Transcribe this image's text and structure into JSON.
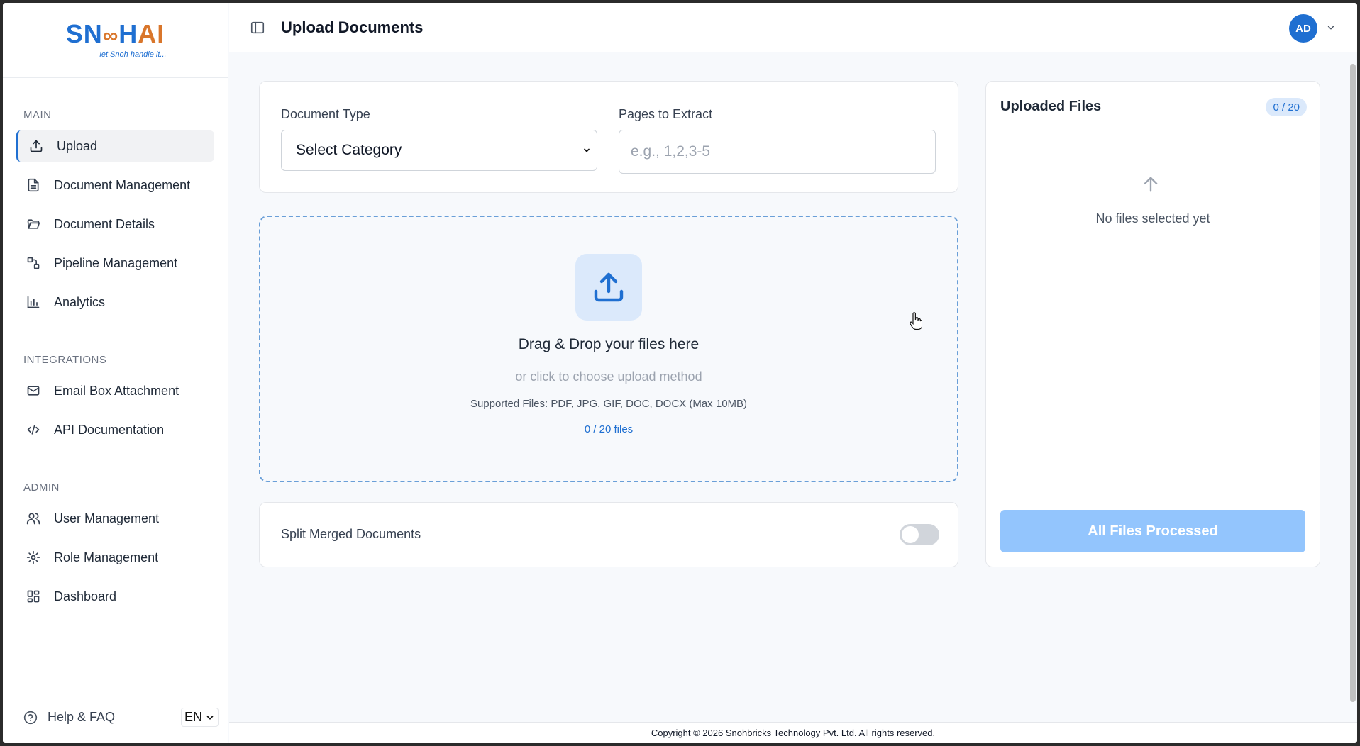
{
  "app": {
    "logo_text_blue": "SN",
    "logo_text_mid": "∞",
    "logo_text_blue2": "H",
    "logo_text_orange": "AI",
    "logo_tagline": "let Snoh handle it...",
    "accent_color": "#1f6fd1"
  },
  "sidebar": {
    "sections": [
      {
        "title": "MAIN"
      },
      {
        "title": "INTEGRATIONS"
      },
      {
        "title": "ADMIN"
      }
    ],
    "items": [
      {
        "label": "Upload",
        "icon": "upload-icon",
        "active": true
      },
      {
        "label": "Document Management",
        "icon": "document-icon"
      },
      {
        "label": "Document Details",
        "icon": "folder-open-icon"
      },
      {
        "label": "Pipeline Management",
        "icon": "pipeline-icon"
      },
      {
        "label": "Analytics",
        "icon": "bar-chart-icon"
      },
      {
        "label": "Email Box Attachment",
        "icon": "mail-icon"
      },
      {
        "label": "API Documentation",
        "icon": "code-icon"
      },
      {
        "label": "User Management",
        "icon": "users-icon"
      },
      {
        "label": "Role Management",
        "icon": "gear-icon"
      },
      {
        "label": "Dashboard",
        "icon": "dashboard-icon"
      }
    ],
    "help_label": "Help & FAQ",
    "language": "EN"
  },
  "header": {
    "title": "Upload Documents",
    "avatar_initials": "AD"
  },
  "form": {
    "document_type_label": "Document Type",
    "document_type_value": "Select Category",
    "pages_label": "Pages to Extract",
    "pages_placeholder": "e.g., 1,2,3-5"
  },
  "dropzone": {
    "title": "Drag & Drop your files here",
    "subtitle": "or click to choose upload method",
    "supported": "Supported Files: PDF, JPG, GIF, DOC, DOCX (Max 10MB)",
    "count": "0 / 20 files"
  },
  "split": {
    "label": "Split Merged Documents",
    "enabled": false
  },
  "uploaded": {
    "title": "Uploaded Files",
    "badge": "0 / 20",
    "empty_text": "No files selected yet",
    "button_label": "All Files Processed"
  },
  "footer": {
    "copyright": "Copyright © 2026 Snohbricks Technology Pvt. Ltd. All rights reserved."
  }
}
